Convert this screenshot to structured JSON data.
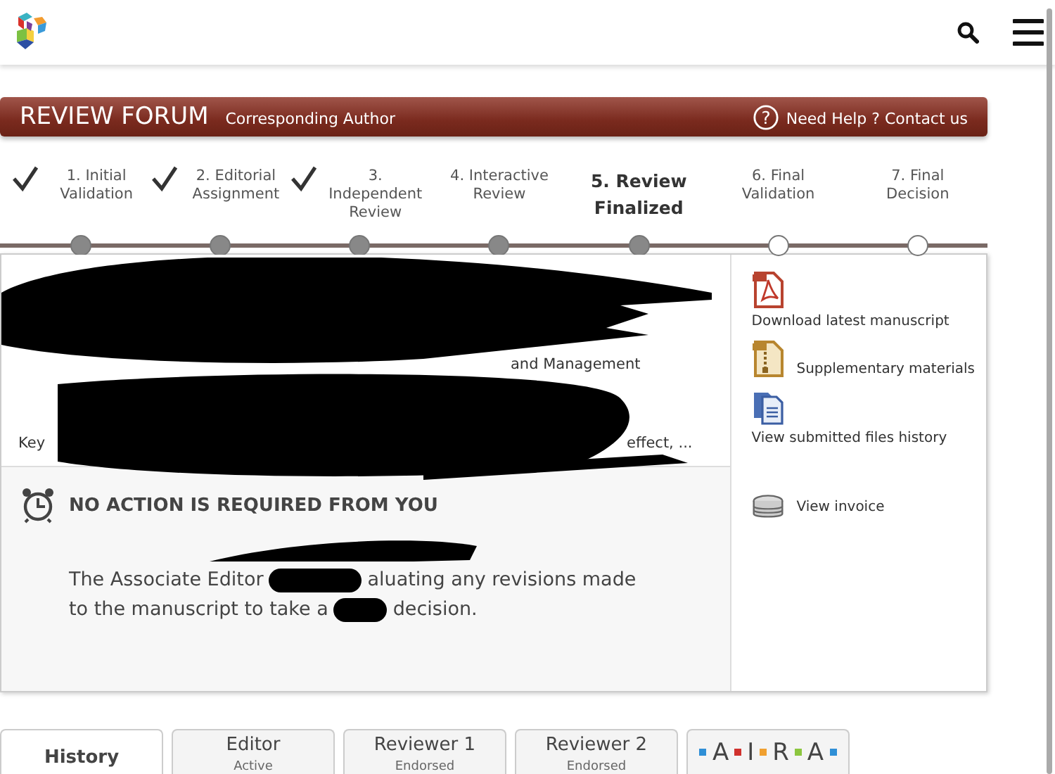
{
  "header": {
    "title": "REVIEW FORUM",
    "role": "Corresponding Author",
    "help_icon": "?",
    "help": "Need Help ? Contact us"
  },
  "steps": [
    {
      "label": "1. Initial Validation",
      "checked": true,
      "reached": true,
      "selected": false
    },
    {
      "label": "2. Editorial Assignment",
      "checked": true,
      "reached": true,
      "selected": false
    },
    {
      "label": "3. Independent Review",
      "checked": true,
      "reached": true,
      "selected": false
    },
    {
      "label": "4. Interactive Review",
      "checked": false,
      "reached": true,
      "selected": false
    },
    {
      "label": "5. Review Finalized",
      "checked": false,
      "reached": true,
      "selected": true
    },
    {
      "label": "6. Final Validation",
      "checked": false,
      "reached": false,
      "selected": false
    },
    {
      "label": "7. Final Decision",
      "checked": false,
      "reached": false,
      "selected": false
    }
  ],
  "article": {
    "fragment_1": "and Management",
    "fragment_2": "Key",
    "fragment_3": "effect, ..."
  },
  "status": {
    "title": "NO ACTION IS REQUIRED FROM YOU",
    "line_1_start": "The Associate Editor",
    "line_1_end": "aluating any revisions made",
    "line_2_start": "to the manuscript to take a",
    "line_2_end": "decision."
  },
  "actions": [
    {
      "kind": "pdf",
      "label": "Download latest manuscript"
    },
    {
      "kind": "zip",
      "label": "Supplementary materials"
    },
    {
      "kind": "files",
      "label": "View submitted files history"
    },
    {
      "kind": "coins",
      "label": "View invoice"
    }
  ],
  "tabs": [
    {
      "kind": "text",
      "label": "History",
      "selected": true
    },
    {
      "kind": "text",
      "label": "Editor",
      "sublabel": "Active",
      "selected": false
    },
    {
      "kind": "text",
      "label": "Reviewer 1",
      "sublabel": "Endorsed",
      "selected": false
    },
    {
      "kind": "text",
      "label": "Reviewer 2",
      "sublabel": "Endorsed",
      "selected": false
    },
    {
      "kind": "logo",
      "letters": [
        "A",
        "I",
        "R",
        "A"
      ],
      "dots": [
        {
          "color": "#2f8fd6"
        },
        {
          "color": "#d0312d"
        },
        {
          "color": "#f0a030"
        },
        {
          "color": "#8cc63f"
        },
        {
          "color": "#2f8fd6"
        }
      ],
      "selected": false
    }
  ]
}
